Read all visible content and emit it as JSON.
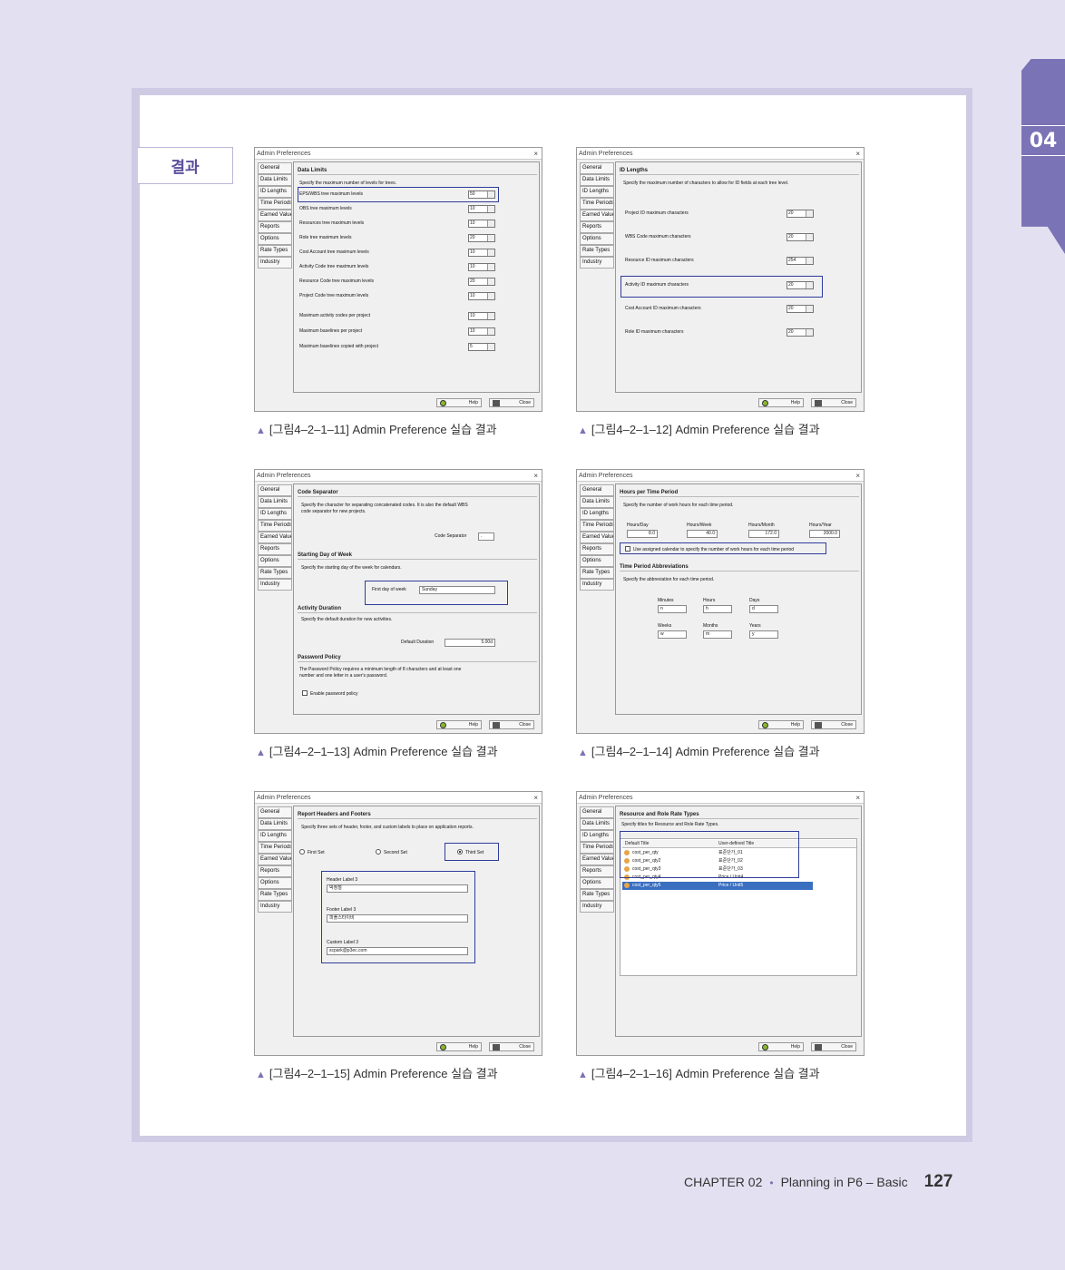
{
  "section_label": "결과",
  "chapter_tab": "04",
  "footer": {
    "chapter": "CHAPTER 02",
    "subtitle": "Planning in P6 – Basic",
    "page": "127"
  },
  "captions": [
    "[그림4–2–1–11] Admin Preference 실습 결과",
    "[그림4–2–1–12] Admin Preference 실습 결과",
    "[그림4–2–1–13] Admin Preference 실습 결과",
    "[그림4–2–1–14] Admin Preference 실습 결과",
    "[그림4–2–1–15] Admin Preference 실습 결과",
    "[그림4–2–1–16] Admin Preference 실습 결과"
  ],
  "dialog": {
    "title": "Admin Preferences",
    "close": "×",
    "nav": [
      "General",
      "Data Limits",
      "ID Lengths",
      "Time Periods",
      "Earned Value",
      "Reports",
      "Options",
      "Rate Types",
      "Industry"
    ],
    "help": "Help",
    "close_btn": "Close"
  },
  "w1": {
    "section": "Data Limits",
    "desc": "Specify the maximum number of levels for trees.",
    "rows": [
      {
        "label": "EPS/WBS tree maximum levels",
        "value": "50"
      },
      {
        "label": "OBS tree maximum levels",
        "value": "10"
      },
      {
        "label": "Resources tree maximum levels",
        "value": "10"
      },
      {
        "label": "Role tree maximum levels",
        "value": "20"
      },
      {
        "label": "Cost Account tree maximum levels",
        "value": "10"
      },
      {
        "label": "Activity Code tree maximum levels",
        "value": "10"
      },
      {
        "label": "Resource Code tree maximum levels",
        "value": "20"
      },
      {
        "label": "Project Code tree maximum levels",
        "value": "10"
      }
    ],
    "rows2": [
      {
        "label": "Maximum activity codes per project",
        "value": "10"
      },
      {
        "label": "Maximum baselines per project",
        "value": "10"
      },
      {
        "label": "Maximum baselines copied with project",
        "value": "5"
      }
    ]
  },
  "w2": {
    "section": "ID Lengths",
    "desc": "Specify the maximum number of characters to allow for ID fields at each tree level.",
    "rows": [
      {
        "label": "Project ID maximum characters",
        "value": "20"
      },
      {
        "label": "WBS Code maximum characters",
        "value": "20"
      },
      {
        "label": "Resource ID maximum characters",
        "value": "254"
      },
      {
        "label": "Activity ID maximum characters",
        "value": "20"
      },
      {
        "label": "Cost Account ID maximum characters",
        "value": "20"
      },
      {
        "label": "Role ID maximum characters",
        "value": "20"
      }
    ]
  },
  "w3": {
    "sec1": "Code Separator",
    "desc1a": "Specify the character for separating concatenated codes.  It is also the default WBS",
    "desc1b": "code separator for new projects.",
    "code_sep_label": "Code Separator",
    "code_sep_value": ".",
    "sec2": "Starting Day of Week",
    "desc2": "Specify the starting day of the week for calendars.",
    "fdow_label": "First day of week",
    "fdow_value": "Sunday",
    "sec3": "Activity Duration",
    "desc3": "Specify the default duration for new activities.",
    "dur_label": "Default Duration",
    "dur_value": "5.00d",
    "sec4": "Password Policy",
    "desc4a": "The Password Policy requires a minimum length of 8 characters and at least one",
    "desc4b": "number and one letter in a user's password.",
    "pw_check": "Enable password policy"
  },
  "w4": {
    "sec1": "Hours per Time Period",
    "desc1": "Specify the number of work hours for each time period.",
    "labels": [
      "Hours/Day",
      "Hours/Week",
      "Hours/Month",
      "Hours/Year"
    ],
    "values": [
      "8.0",
      "40.0",
      "172.0",
      "2000.0"
    ],
    "check": "Use assigned calendar to specify the number of work hours for each time period",
    "sec2": "Time Period Abbreviations",
    "desc2": "Specify the abbreviation for each time period.",
    "abbr": [
      {
        "label": "Minutes",
        "value": "n"
      },
      {
        "label": "Hours",
        "value": "h"
      },
      {
        "label": "Days",
        "value": "d"
      },
      {
        "label": "Weeks",
        "value": "w"
      },
      {
        "label": "Months",
        "value": "m"
      },
      {
        "label": "Years",
        "value": "y"
      }
    ]
  },
  "w5": {
    "sec": "Report Headers and Footers",
    "desc": "Specify three sets of header, footer, and custom labels to place on application reports.",
    "radios": [
      "First Set",
      "Second Set",
      "Third Set"
    ],
    "header_label": "Header Label 3",
    "header_value": "박정철",
    "footer_label": "Footer Label 3",
    "footer_value": "피플스타이비",
    "custom_label": "Custom Label 3",
    "custom_value": "scpark@p3ec.com"
  },
  "w6": {
    "sec": "Resource and Role Rate Types",
    "desc": "Specify titles for Resource and Role Rate Types.",
    "col1": "Default Title",
    "col2": "User-defined Title",
    "rows": [
      {
        "d": "cost_per_qty",
        "u": "표준단가_01"
      },
      {
        "d": "cost_per_qty2",
        "u": "표준단가_02"
      },
      {
        "d": "cost_per_qty3",
        "u": "표준단가_03"
      },
      {
        "d": "cost_per_qty4",
        "u": "Price / Unit4"
      },
      {
        "d": "cost_per_qty5",
        "u": "Price / Unit5"
      }
    ]
  }
}
